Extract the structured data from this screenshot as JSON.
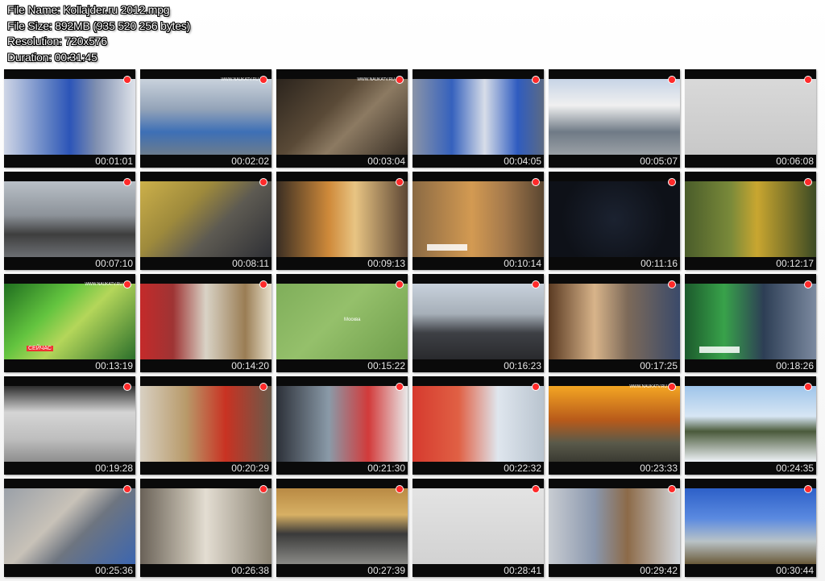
{
  "file_info": {
    "name": "File Name: Kollajder.ru 2012.mpg",
    "size": "File Size: 892MB (935 520 256 bytes)",
    "resolution": "Resolution: 720x576",
    "duration": "Duration: 00:31:45"
  },
  "site_watermark": "WWW.NAUKATV.RU",
  "frames": [
    {
      "time": "00:01:01",
      "bg": "linear-gradient(90deg,#cfd6e6 0%,#5b7cc2 35%,#2c55b8 50%,#7f8fb0 70%,#dfe3ea 100%)"
    },
    {
      "time": "00:02:02",
      "bg": "linear-gradient(180deg,#c9d2dc 0%,#93a3b8 40%,#3d6fb6 70%,#6b7c8e 100%)",
      "site": true
    },
    {
      "time": "00:03:04",
      "bg": "linear-gradient(135deg,#2b241d 0%,#5a4a37 40%,#8c7a62 60%,#3b3127 100%)",
      "site": true
    },
    {
      "time": "00:04:05",
      "bg": "linear-gradient(90deg,#8a94a8 0%,#3561bd 30%,#d7dde8 55%,#2f5cc0 80%,#5b6a84 100%)"
    },
    {
      "time": "00:05:07",
      "bg": "linear-gradient(180deg,#c7d4e6 0%,#f0f0f0 35%,#6f7a86 70%,#9aa0a5 100%)"
    },
    {
      "time": "00:06:08",
      "bg": "linear-gradient(180deg,#d9d9d9 0%,#c8c8c8 100%)"
    },
    {
      "time": "00:07:10",
      "bg": "linear-gradient(180deg,#b9c0c7 0%,#8c9299 45%,#3e3e3e 70%,#6c6f73 100%)"
    },
    {
      "time": "00:08:11",
      "bg": "linear-gradient(135deg,#ccb04a 0%,#9e8a3c 35%,#5d5a52 60%,#2f3035 100%)"
    },
    {
      "time": "00:09:13",
      "bg": "linear-gradient(90deg,#3a2e23 0%,#cf8a3a 40%,#e8c483 60%,#5c4634 100%)"
    },
    {
      "time": "00:10:14",
      "bg": "linear-gradient(90deg,#8b6a44 0%,#d39a52 45%,#a57a4c 70%,#5a4631 100%)",
      "caption": true
    },
    {
      "time": "00:11:16",
      "bg": "radial-gradient(circle at 50% 50%,#1b2230 0%,#0e1118 70%)"
    },
    {
      "time": "00:12:17",
      "bg": "linear-gradient(90deg,#4a5c2a 0%,#7a8a3a 35%,#c9a630 55%,#3c4a24 100%)"
    },
    {
      "time": "00:13:19",
      "bg": "linear-gradient(135deg,#1f6e1f 0%,#63c43f 35%,#b4d65a 55%,#2b6f2b 100%)",
      "site": true,
      "overlay": "СЕЙЧАС"
    },
    {
      "time": "00:14:20",
      "bg": "linear-gradient(90deg,#c42a2a 0%,#9e3434 25%,#d9d3c6 50%,#9a7d54 80%,#e8e0cc 100%)"
    },
    {
      "time": "00:15:22",
      "bg": "linear-gradient(135deg,#7fae5a 0%,#95c06b 45%,#6f9e4b 100%)",
      "overlay": "Москва"
    },
    {
      "time": "00:16:23",
      "bg": "linear-gradient(180deg,#c8d1dc 0%,#a6afb8 40%,#3e4045 65%,#292a2d 100%)"
    },
    {
      "time": "00:17:25",
      "bg": "linear-gradient(90deg,#5a3a22 0%,#d8b48a 35%,#7d6a59 60%,#3a4a6a 100%)"
    },
    {
      "time": "00:18:26",
      "bg": "linear-gradient(90deg,#1c5a2c 0%,#38a24a 30%,#2d3e55 60%,#7c8aa0 100%)",
      "caption": true
    },
    {
      "time": "00:19:28",
      "bg": "linear-gradient(180deg,#2d2d2d 0%,#d5d5d5 35%,#bebebe 70%,#8e8e8e 100%)"
    },
    {
      "time": "00:20:29",
      "bg": "linear-gradient(90deg,#d8d0c2 0%,#b89a6a 35%,#c93222 65%,#6a5a4a 100%)"
    },
    {
      "time": "00:21:30",
      "bg": "linear-gradient(90deg,#2c3038 0%,#8a9aa8 40%,#d23a3a 70%,#e9e9e9 100%)"
    },
    {
      "time": "00:22:32",
      "bg": "linear-gradient(90deg,#d63a2e 0%,#e06044 35%,#dfe6ee 65%,#b9c4cf 100%)"
    },
    {
      "time": "00:23:33",
      "bg": "linear-gradient(180deg,#f4a623 0%,#b85a1a 45%,#5a5a4a 75%,#3a3a32 100%)",
      "site": true
    },
    {
      "time": "00:24:35",
      "bg": "linear-gradient(180deg,#9ec4ea 0%,#d7e6f4 40%,#4a5a3a 60%,#eef2f6 100%)"
    },
    {
      "time": "00:25:36",
      "bg": "linear-gradient(135deg,#9aa0a8 0%,#c8c2b8 40%,#6e7580 60%,#3c66b0 100%)"
    },
    {
      "time": "00:26:38",
      "bg": "linear-gradient(90deg,#6a6258 0%,#bdb6a8 35%,#e3ddd2 50%,#8a8272 100%)"
    },
    {
      "time": "00:27:39",
      "bg": "linear-gradient(180deg,#b98a44 0%,#d7b064 35%,#3a3a3a 60%,#8a8a86 100%)"
    },
    {
      "time": "00:28:41",
      "bg": "linear-gradient(180deg,#e3e3e3 0%,#d2d2d2 100%)"
    },
    {
      "time": "00:29:42",
      "bg": "linear-gradient(90deg,#c8ccd2 0%,#8a97ad 35%,#8c6a48 60%,#d3d7dc 100%)"
    },
    {
      "time": "00:30:44",
      "bg": "linear-gradient(180deg,#2d60c8 0%,#5b8ae0 40%,#b9c3c7 70%,#6a5a3a 100%)"
    }
  ]
}
